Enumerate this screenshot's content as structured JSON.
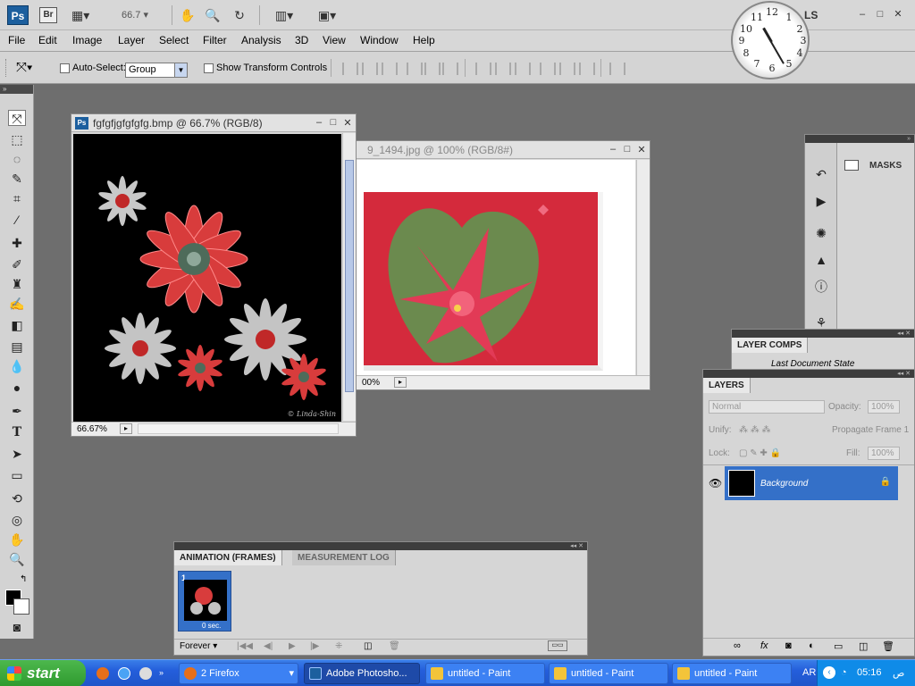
{
  "appbar": {
    "ps_logo": "Ps",
    "br_logo": "Br",
    "zoom_value": "66.7",
    "workspace": "LS",
    "icons": [
      "view-extras-icon",
      "hand-icon",
      "zoom-icon",
      "rotate-view-icon",
      "arrange-docs-icon",
      "screen-mode-icon"
    ]
  },
  "menu": [
    "File",
    "Edit",
    "Image",
    "Layer",
    "Select",
    "Filter",
    "Analysis",
    "3D",
    "View",
    "Window",
    "Help"
  ],
  "options": {
    "auto_select_label": "Auto-Select:",
    "auto_select_value": "Group",
    "transform_label": "Show Transform Controls"
  },
  "doc1": {
    "title": "fgfgfjgfgfgfg.bmp @ 66.7% (RGB/8)",
    "zoom": "66.67%",
    "signature": "© Linda-Shin"
  },
  "doc2": {
    "title": "9_1494.jpg @ 100% (RGB/8#)",
    "zoom": "00%"
  },
  "masks_panel": {
    "label": "MASKS"
  },
  "layer_comps": {
    "tab": "LAYER COMPS",
    "item": "Last Document State"
  },
  "layers": {
    "tab": "LAYERS",
    "blend_mode": "Normal",
    "opacity_label": "Opacity:",
    "opacity_value": "100%",
    "unify_label": "Unify:",
    "propagate_label": "Propagate Frame 1",
    "lock_label": "Lock:",
    "fill_label": "Fill:",
    "fill_value": "100%",
    "layer_name": "Background"
  },
  "animation": {
    "tab_animation": "ANIMATION (FRAMES)",
    "tab_measurement": "MEASUREMENT LOG",
    "frame_number": "1",
    "frame_delay": "0 sec.",
    "loop": "Forever"
  },
  "taskbar": {
    "start": "start",
    "items": [
      "2 Firefox",
      "Adobe Photosho...",
      "untitled - Paint",
      "untitled - Paint",
      "untitled - Paint"
    ],
    "lang": "AR",
    "time": "05:16",
    "ampm": "ص"
  },
  "clock": {
    "numbers": [
      "12",
      "1",
      "2",
      "3",
      "4",
      "5",
      "6",
      "7",
      "8",
      "9",
      "10",
      "11"
    ]
  },
  "colors": {
    "ps_blue": "#1c5f9e",
    "selection": "#3470c8",
    "taskbar": "#245edb",
    "start": "#2e9a2e"
  }
}
